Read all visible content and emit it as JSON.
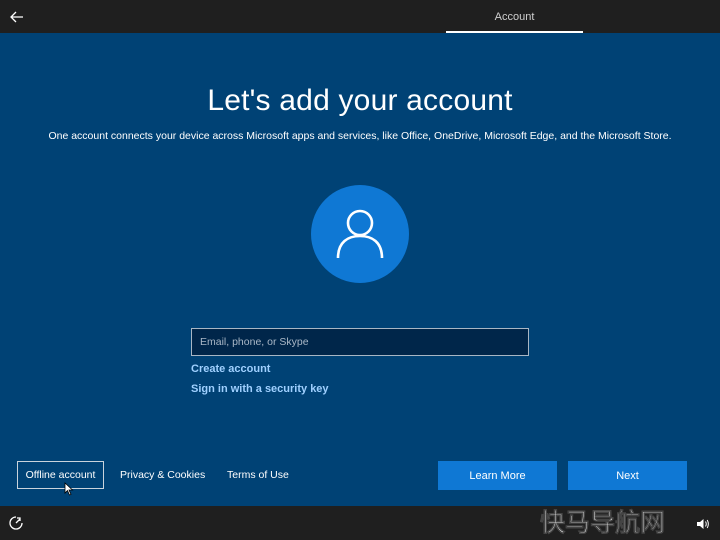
{
  "header": {
    "tab_label": "Account"
  },
  "main": {
    "title": "Let's add your account",
    "subtitle": "One account connects your device across Microsoft apps and services, like Office, OneDrive, Microsoft Edge, and the Microsoft Store.",
    "email_placeholder": "Email, phone, or Skype",
    "email_value": "",
    "create_account": "Create account",
    "security_key": "Sign in with a security key"
  },
  "footer": {
    "offline_account": "Offline account",
    "privacy": "Privacy & Cookies",
    "terms": "Terms of Use",
    "learn_more": "Learn More",
    "next": "Next"
  },
  "watermark": {
    "text": "快马导航网"
  },
  "icons": {
    "back": "back-arrow-icon",
    "avatar": "user-icon",
    "ease_of_access": "ease-of-access-icon",
    "volume": "volume-icon",
    "cursor": "mouse-pointer-icon"
  },
  "colors": {
    "background": "#004275",
    "accent": "#0f78d4",
    "link": "#9fd0ff",
    "bar": "#1f1f1f"
  }
}
